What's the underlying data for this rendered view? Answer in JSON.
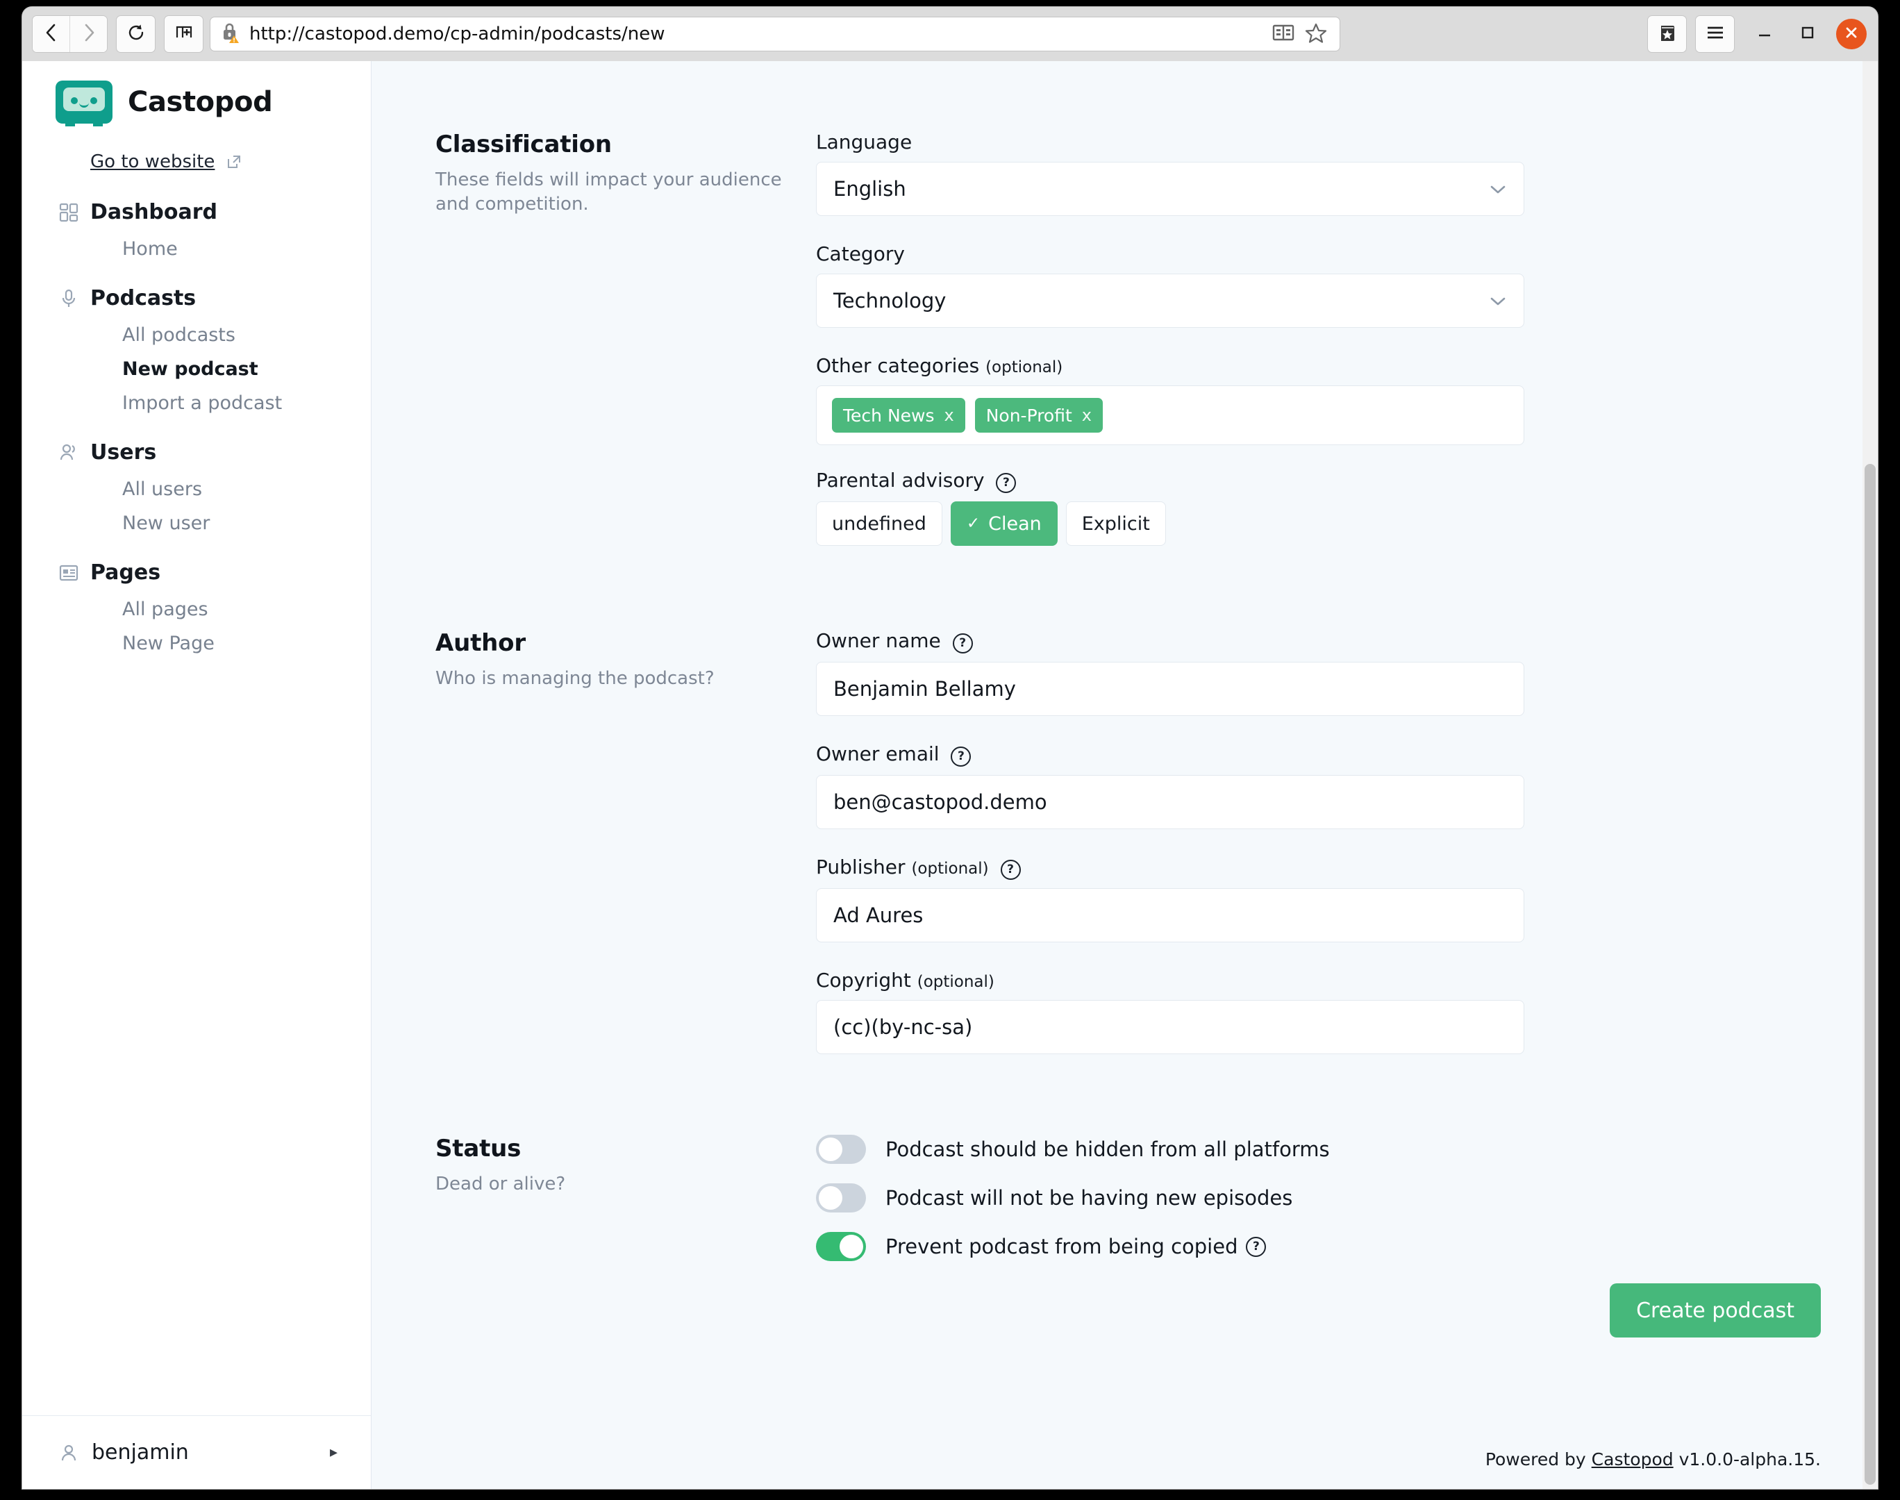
{
  "browser": {
    "url": "http://castopod.demo/cp-admin/podcasts/new",
    "back_icon": "back-arrow-icon",
    "forward_icon": "forward-arrow-icon",
    "reload_icon": "reload-icon",
    "newtab_icon": "new-tab-icon",
    "security_icon": "insecure-lock-warning-icon",
    "reader_icon": "reader-view-icon",
    "bookmark_icon": "star-bookmark-icon",
    "library_icon": "library-bookmarks-icon",
    "menu_icon": "hamburger-menu-icon",
    "minimize_icon": "minimize-icon",
    "maximize_icon": "maximize-icon",
    "close_icon": "close-icon"
  },
  "sidebar": {
    "brand": "Castopod",
    "logo_icon": "castopod-cassette-logo",
    "go_to_website": "Go to website",
    "external_icon": "external-link-icon",
    "groups": [
      {
        "label": "Dashboard",
        "icon": "dashboard-grid-icon",
        "items": [
          {
            "label": "Home",
            "active": false
          }
        ]
      },
      {
        "label": "Podcasts",
        "icon": "microphone-icon",
        "items": [
          {
            "label": "All podcasts",
            "active": false
          },
          {
            "label": "New podcast",
            "active": true
          },
          {
            "label": "Import a podcast",
            "active": false
          }
        ]
      },
      {
        "label": "Users",
        "icon": "users-icon",
        "items": [
          {
            "label": "All users",
            "active": false
          },
          {
            "label": "New user",
            "active": false
          }
        ]
      },
      {
        "label": "Pages",
        "icon": "pages-article-icon",
        "items": [
          {
            "label": "All pages",
            "active": false
          },
          {
            "label": "New Page",
            "active": false
          }
        ]
      }
    ],
    "user": {
      "name": "benjamin",
      "avatar_icon": "user-avatar-icon",
      "caret_icon": "caret-right-icon"
    }
  },
  "form": {
    "classification": {
      "title": "Classification",
      "description": "These fields will impact your audience and competition.",
      "language": {
        "label": "Language",
        "value": "English",
        "chevron_icon": "chevron-down-icon"
      },
      "category": {
        "label": "Category",
        "value": "Technology",
        "chevron_icon": "chevron-down-icon"
      },
      "other_categories": {
        "label": "Other categories",
        "optional": "(optional)",
        "tags": [
          {
            "label": "Tech News",
            "remove_icon": "x"
          },
          {
            "label": "Non-Profit",
            "remove_icon": "x"
          }
        ]
      },
      "parental_advisory": {
        "label": "Parental advisory",
        "help_icon": "question-mark-icon",
        "options": [
          {
            "label": "undefined",
            "selected": false
          },
          {
            "label": "Clean",
            "selected": true,
            "check": "✓"
          },
          {
            "label": "Explicit",
            "selected": false
          }
        ]
      }
    },
    "author": {
      "title": "Author",
      "description": "Who is managing the podcast?",
      "owner_name": {
        "label": "Owner name",
        "help_icon": "question-mark-icon",
        "value": "Benjamin Bellamy"
      },
      "owner_email": {
        "label": "Owner email",
        "help_icon": "question-mark-icon",
        "value": "ben@castopod.demo"
      },
      "publisher": {
        "label": "Publisher",
        "optional": "(optional)",
        "help_icon": "question-mark-icon",
        "value": "Ad Aures"
      },
      "copyright": {
        "label": "Copyright",
        "optional": "(optional)",
        "value": "(cc)(by-nc-sa)"
      }
    },
    "status": {
      "title": "Status",
      "description": "Dead or alive?",
      "toggles": [
        {
          "label": "Podcast should be hidden from all platforms",
          "on": false,
          "help": false
        },
        {
          "label": "Podcast will not be having new episodes",
          "on": false,
          "help": false
        },
        {
          "label": "Prevent podcast from being copied",
          "on": true,
          "help": true,
          "help_icon": "question-mark-icon"
        }
      ]
    },
    "submit_label": "Create podcast"
  },
  "footer": {
    "prefix": "Powered by",
    "link": "Castopod",
    "version": "v1.0.0-alpha.15."
  },
  "colors": {
    "brand_teal": "#0f9e8c",
    "accent_green": "#4cb97d",
    "toggle_on": "#35bb72",
    "page_bg": "#f5f9fc",
    "sidebar_bg": "#ffffff"
  }
}
